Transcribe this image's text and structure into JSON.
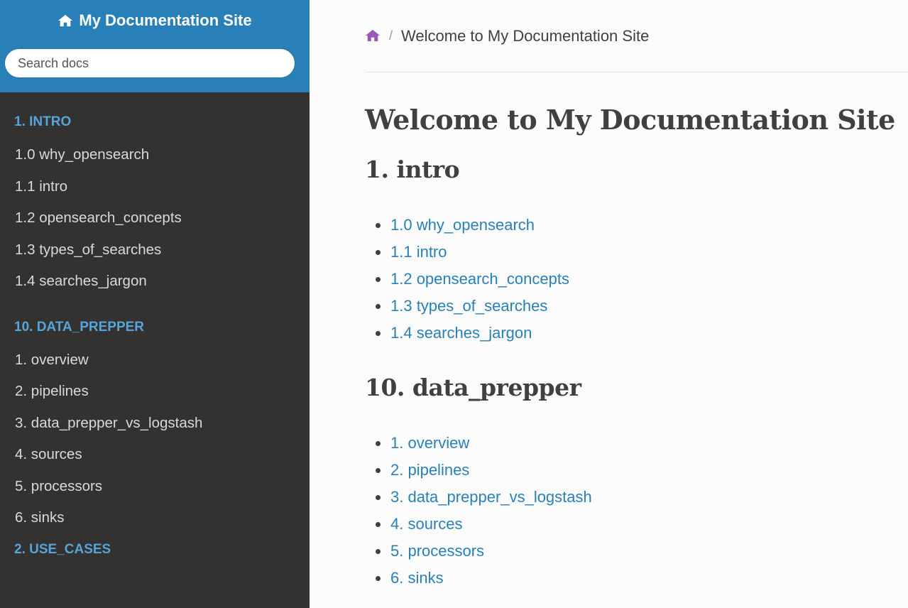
{
  "site": {
    "title": "My Documentation Site"
  },
  "search": {
    "placeholder": "Search docs"
  },
  "sidebar": {
    "sections": [
      {
        "caption": "1. INTRO",
        "items": [
          "1.0 why_opensearch",
          "1.1 intro",
          "1.2 opensearch_concepts",
          "1.3 types_of_searches",
          "1.4 searches_jargon"
        ]
      },
      {
        "caption": "10. DATA_PREPPER",
        "items": [
          "1. overview",
          "2. pipelines",
          "3. data_prepper_vs_logstash",
          "4. sources",
          "5. processors",
          "6. sinks"
        ]
      },
      {
        "caption": "2. USE_CASES",
        "items": []
      }
    ]
  },
  "breadcrumb": {
    "separator": "/",
    "current": "Welcome to My Documentation Site"
  },
  "main": {
    "title": "Welcome to My Documentation Site",
    "sections": [
      {
        "heading": "1. intro",
        "links": [
          "1.0 why_opensearch",
          "1.1 intro",
          "1.2 opensearch_concepts",
          "1.3 types_of_searches",
          "1.4 searches_jargon"
        ]
      },
      {
        "heading": "10. data_prepper",
        "links": [
          "1. overview",
          "2. pipelines",
          "3. data_prepper_vs_logstash",
          "4. sources",
          "5. processors",
          "6. sinks"
        ]
      }
    ]
  },
  "icons": {
    "site_logo": "home-icon",
    "breadcrumb_home": "home-icon"
  },
  "colors": {
    "sidebar_top": "#2980b9",
    "sidebar_bg": "#343131",
    "caption": "#55a5d9",
    "link": "#2980b9",
    "breadcrumb_home": "#9b59b6"
  }
}
